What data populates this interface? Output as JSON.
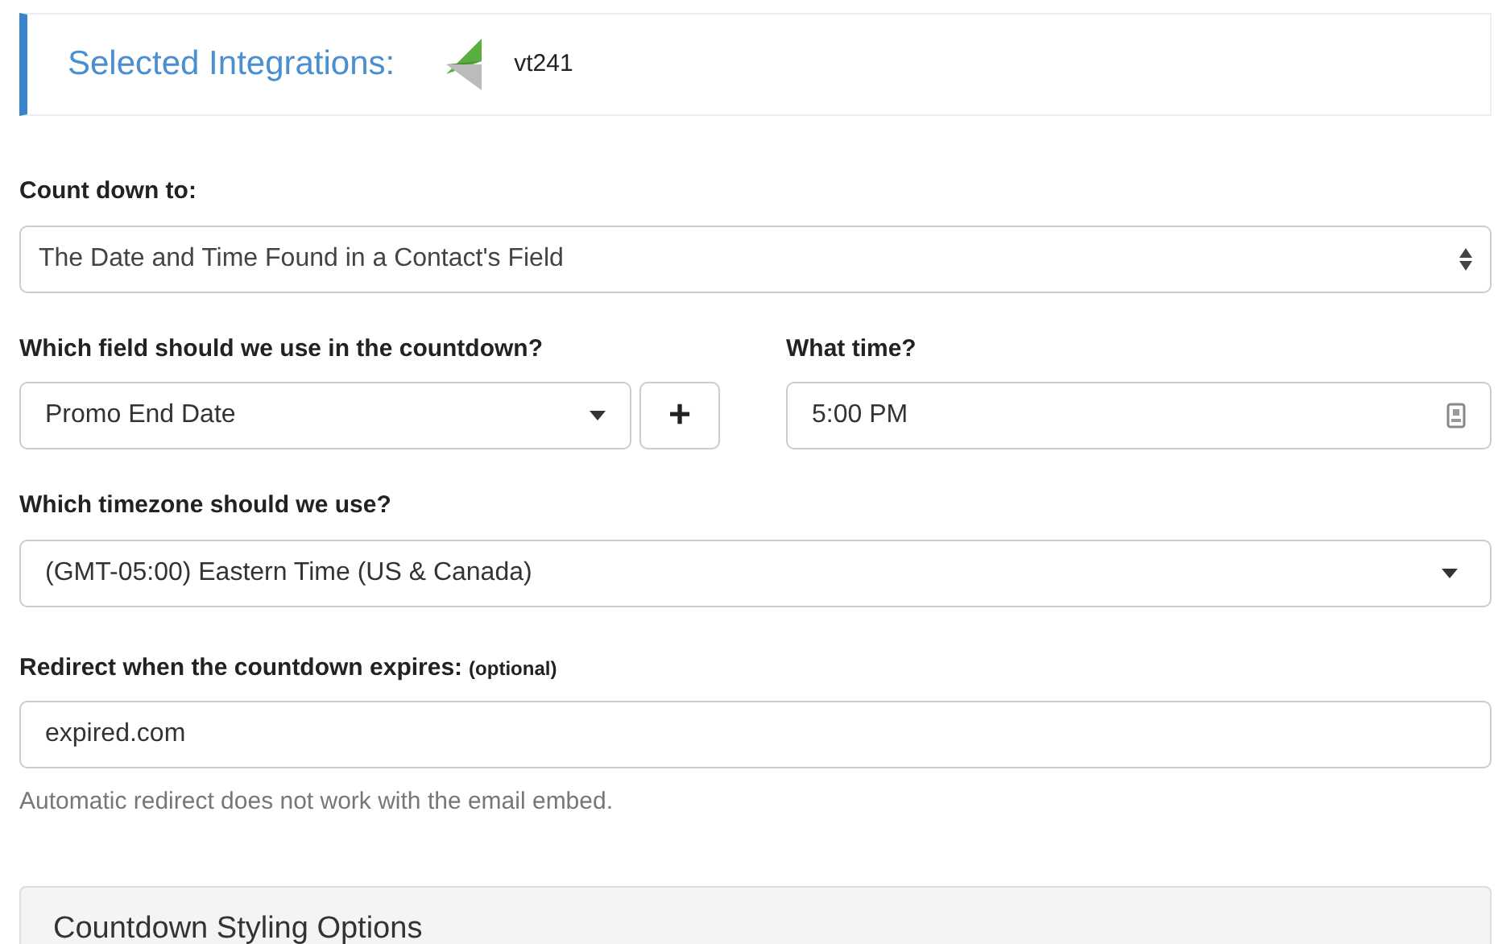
{
  "integrations": {
    "label": "Selected Integrations:",
    "name": "vt241"
  },
  "countdown_to": {
    "label": "Count down to:",
    "value": "The Date and Time Found in a Contact's Field"
  },
  "field": {
    "label": "Which field should we use in the countdown?",
    "value": "Promo End Date",
    "add_button": "+"
  },
  "time": {
    "label": "What time?",
    "value": "5:00 PM"
  },
  "timezone": {
    "label": "Which timezone should we use?",
    "value": "(GMT-05:00) Eastern Time (US & Canada)"
  },
  "redirect": {
    "label": "Redirect when the countdown expires:",
    "optional": "(optional)",
    "value": "expired.com",
    "help": "Automatic redirect does not work with the email embed."
  },
  "styling_panel": {
    "title": "Countdown Styling Options"
  }
}
